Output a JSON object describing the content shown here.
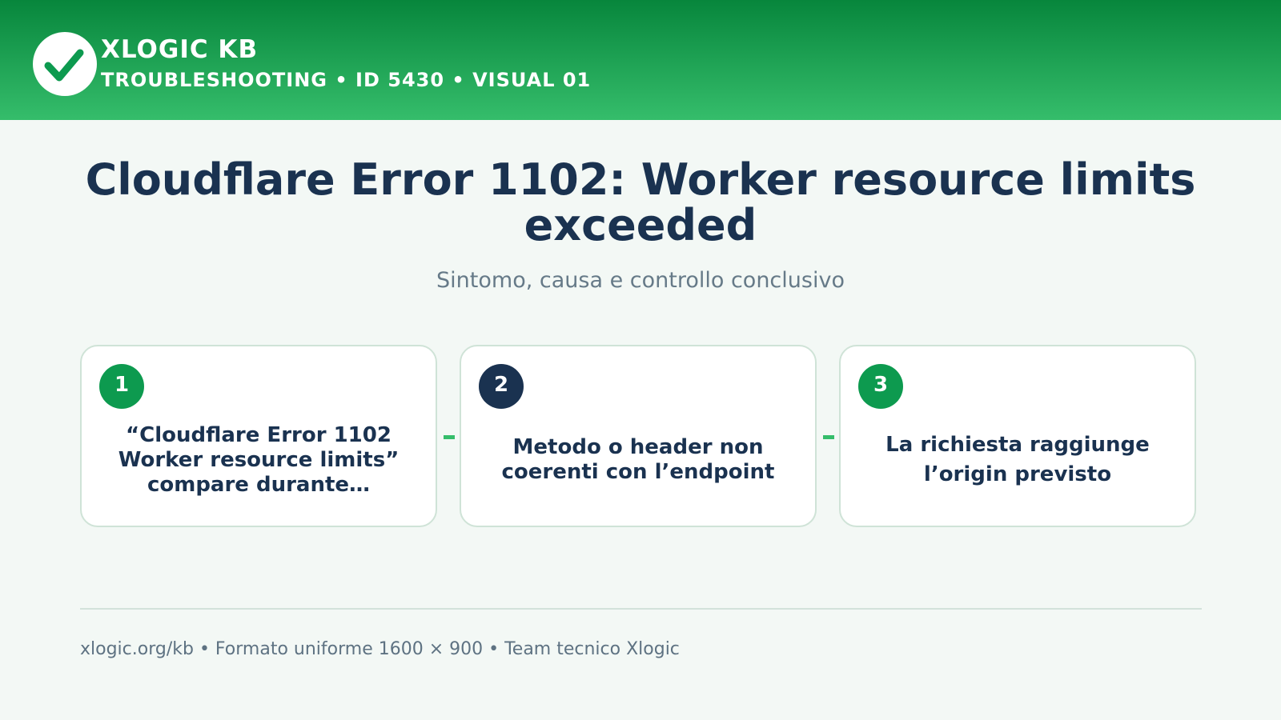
{
  "header": {
    "brand": "XLOGIC KB",
    "breadcrumb": "TROUBLESHOOTING • ID 5430 • VISUAL 01",
    "logo_icon": "checkmark-icon",
    "gradient_colors": [
      "#07863c",
      "#35bd6b"
    ]
  },
  "main": {
    "title": "Cloudflare Error 1102: Worker resource limits exceeded",
    "subtitle": "Sintomo, causa e controllo conclusivo"
  },
  "steps": [
    {
      "number": "1",
      "text": "“Cloudflare Error 1102 Worker resource limits” compare durante…",
      "badge_color": "#0d9a4f"
    },
    {
      "number": "2",
      "text": "Metodo o header non coerenti con l’endpoint",
      "badge_color": "#1a3250"
    },
    {
      "number": "3",
      "text": "La richiesta raggiunge l’origin previsto",
      "badge_color": "#0d9a4f"
    }
  ],
  "footer": {
    "text": "xlogic.org/kb • Formato uniforme 1600 × 900 • Team tecnico Xlogic"
  },
  "colors": {
    "accent_green": "#35bd6b",
    "navy": "#1a3250",
    "background": "#f3f8f5"
  }
}
